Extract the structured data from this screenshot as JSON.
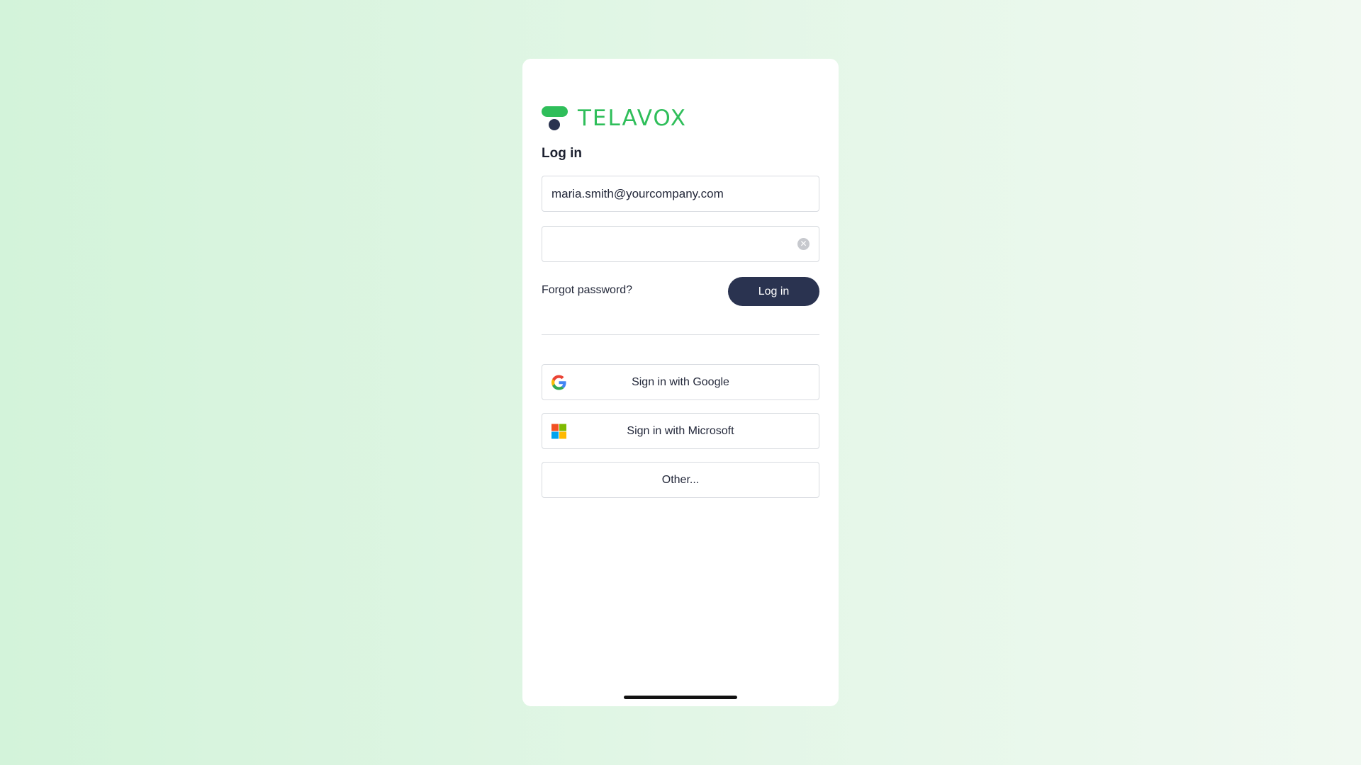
{
  "brand": {
    "name": "TELAVOX",
    "accent_color": "#2fbe5a",
    "dark_color": "#2a3350"
  },
  "login": {
    "title": "Log in",
    "email_value": "maria.smith@yourcompany.com",
    "password_value": "",
    "clear_icon": "clear-circle-icon",
    "forgot_label": "Forgot password?",
    "submit_label": "Log in"
  },
  "sso": {
    "google_label": "Sign in with Google",
    "google_icon": "google-icon",
    "microsoft_label": "Sign in with Microsoft",
    "microsoft_icon": "microsoft-icon",
    "other_label": "Other..."
  }
}
